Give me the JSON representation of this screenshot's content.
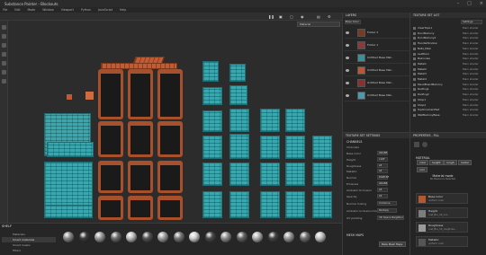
{
  "app": {
    "title": "Substance Painter - Blockouts"
  },
  "menu": [
    "File",
    "Edit",
    "Mode",
    "Window",
    "Viewport",
    "Python",
    "JavaScript",
    "Help"
  ],
  "viewport": {
    "mode_select": "Material"
  },
  "layers": {
    "title": "LAYERS",
    "blend_mode": "Base Color",
    "items": [
      {
        "name": "Folder 2",
        "swatch": "#7a3a22"
      },
      {
        "name": "Folder 1",
        "swatch": "#8a3a3a"
      },
      {
        "name": "Untitled Base Mat..",
        "swatch": "#3a8f9c"
      },
      {
        "name": "Untitled Base Mat..",
        "swatch": "#c0562f"
      },
      {
        "name": "Untitled Base Mat..",
        "swatch": "#8b2f2f"
      },
      {
        "name": "Untitled Base Mat..",
        "swatch": "#4b9bb0"
      }
    ]
  },
  "texture_set_list": {
    "title": "TEXTURE SET LIST",
    "settings_label": "Settings",
    "items": [
      {
        "name": "ClearTopo1",
        "shader": "Main shader"
      },
      {
        "name": "DoorBalcony",
        "shader": "Main shader"
      },
      {
        "name": "DoorBalcony2",
        "shader": "Main shader"
      },
      {
        "name": "HandleWindow",
        "shader": "Main shader"
      },
      {
        "name": "Balls_Main",
        "shader": "Main shader"
      },
      {
        "name": "LeafDoor",
        "shader": "Main shader"
      },
      {
        "name": "Balconies",
        "shader": "Main shader"
      },
      {
        "name": "Metal1",
        "shader": "Main shader"
      },
      {
        "name": "Metal2",
        "shader": "Main shader"
      },
      {
        "name": "Metal3",
        "shader": "Main shader"
      },
      {
        "name": "Metal4",
        "shader": "Main shader"
      },
      {
        "name": "PanelBoardBalcony",
        "shader": "Main shader"
      },
      {
        "name": "Roofing1",
        "shader": "Main shader"
      },
      {
        "name": "Roofing2",
        "shader": "Main shader"
      },
      {
        "name": "Shop1",
        "shader": "Main shader"
      },
      {
        "name": "Shop2",
        "shader": "Main shader"
      },
      {
        "name": "TopOrnamentSet",
        "shader": "Main shader"
      },
      {
        "name": "WallBalconyBase",
        "shader": "Main shader"
      }
    ]
  },
  "texture_set_settings": {
    "title": "TEXTURE SET SETTINGS",
    "channels_title": "CHANNELS",
    "channels_label": "Channels",
    "channels": [
      {
        "name": "Base Color",
        "fmt": "sRGB8"
      },
      {
        "name": "Height",
        "fmt": "L16F"
      },
      {
        "name": "Roughness",
        "fmt": "L8"
      },
      {
        "name": "Metallic",
        "fmt": "L8"
      },
      {
        "name": "Normal",
        "fmt": "RGB16F"
      },
      {
        "name": "Emissive",
        "fmt": "sRGB8"
      },
      {
        "name": "Ambient Occlusion",
        "fmt": "L8"
      },
      {
        "name": "Opacity",
        "fmt": "L8"
      }
    ],
    "normal_mixing_label": "Normal mixing",
    "normal_mixing_value": "Combine",
    "ao_mixing_label": "Ambient occlusion mixing",
    "ao_mixing_value": "Multiply",
    "uv_padding_label": "UV padding",
    "uv_padding_value": "3D Space Neighbor",
    "mesh_maps_title": "MESH MAPS",
    "bake_button": "Bake Mesh Maps"
  },
  "properties": {
    "title": "PROPERTIES - FILL",
    "section": "MATERIAL",
    "toggles": [
      "color",
      "height",
      "rough",
      "metal",
      "nrm"
    ],
    "material_mode": "Material mode",
    "material_mode_sub": "No Resource Selected",
    "slots": [
      {
        "label": "Base Color",
        "file": "uniform color",
        "swatch": "#b4582f"
      },
      {
        "label": "Height",
        "file": "rust_Bru_10_col...",
        "swatch": "#7d7d7d"
      },
      {
        "label": "Roughness",
        "file": "rust_Bru_10_roughnes...",
        "swatch": "#9a9a9a"
      },
      {
        "label": "Metallic",
        "file": "uniform color",
        "swatch": "#555555"
      }
    ]
  },
  "shelf": {
    "title": "SHELF",
    "categories": [
      "Materials",
      "Smart materials",
      "Smart masks",
      "Filters",
      "Brushes"
    ],
    "balls": [
      "#8b8b8b",
      "#3c3c3c",
      "#9a9a9a",
      "#6c6c6c",
      "#bdbdbd",
      "#555",
      "#a0a0a0",
      "#777",
      "#cfcfcf",
      "#4b4b4b",
      "#8f8f8f",
      "#636363",
      "#b1b1b1",
      "#444",
      "#999",
      "#6f6f6f",
      "#c3c3c3"
    ]
  }
}
